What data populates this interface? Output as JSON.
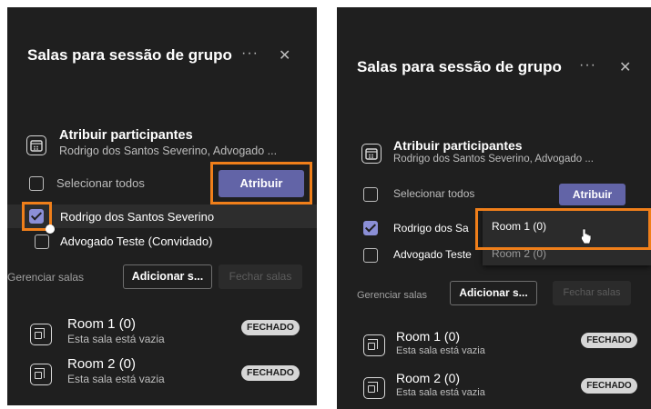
{
  "left": {
    "title": "Salas para sessão de grupo",
    "more": "···",
    "close": "✕",
    "assign": {
      "title": "Atribuir participantes",
      "subtitle": "Rodrigo dos Santos Severino, Advogado ..."
    },
    "select_all": "Selecionar todos",
    "assign_button": "Atribuir",
    "participants": [
      {
        "name": "Rodrigo dos Santos Severino",
        "checked": true
      },
      {
        "name": "Advogado Teste (Convidado)",
        "checked": false
      }
    ],
    "manage_label": "Gerenciar salas",
    "add_button": "Adicionar s...",
    "close_rooms": "Fechar salas",
    "rooms": [
      {
        "name": "Room 1 (0)",
        "status": "Esta sala está vazia",
        "badge": "FECHADO"
      },
      {
        "name": "Room 2 (0)",
        "status": "Esta sala está vazia",
        "badge": "FECHADO"
      }
    ]
  },
  "right": {
    "title": "Salas para sessão de grupo",
    "more": "···",
    "close": "✕",
    "assign": {
      "title": "Atribuir participantes",
      "subtitle": "Rodrigo dos Santos Severino, Advogado ..."
    },
    "select_all": "Selecionar todos",
    "assign_button": "Atribuir",
    "participants": [
      {
        "name": "Rodrigo dos Sa",
        "checked": true
      },
      {
        "name": "Advogado Teste",
        "checked": false
      }
    ],
    "dropdown": [
      "Room 1 (0)",
      "Room 2 (0)"
    ],
    "manage_label": "Gerenciar salas",
    "add_button": "Adicionar s...",
    "close_rooms": "Fechar salas",
    "rooms": [
      {
        "name": "Room 1 (0)",
        "status": "Esta sala está vazia",
        "badge": "FECHADO"
      },
      {
        "name": "Room 2 (0)",
        "status": "Esta sala está vazia",
        "badge": "FECHADO"
      }
    ]
  },
  "colors": {
    "panel_bg": "#1f1f1f",
    "accent": "#6264a7",
    "highlight": "#f07f1a",
    "badge_bg": "#d6d6d6"
  }
}
